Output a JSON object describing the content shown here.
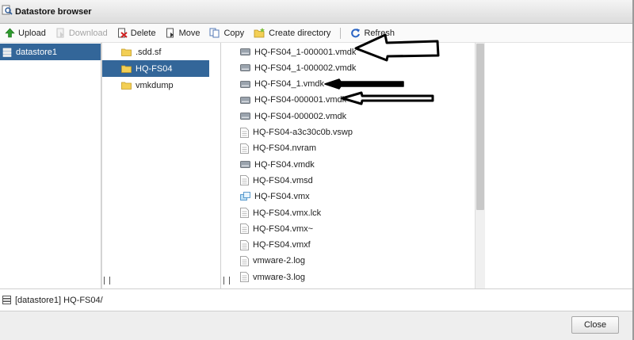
{
  "window": {
    "title": "Datastore browser"
  },
  "toolbar": {
    "upload": "Upload",
    "download": "Download",
    "delete": "Delete",
    "move": "Move",
    "copy": "Copy",
    "create_directory": "Create directory",
    "refresh": "Refresh"
  },
  "datastores": [
    {
      "label": "datastore1",
      "selected": true
    }
  ],
  "folders": [
    {
      "label": ".sdd.sf",
      "selected": false
    },
    {
      "label": "HQ-FS04",
      "selected": true
    },
    {
      "label": "vmkdump",
      "selected": false
    }
  ],
  "files": [
    {
      "label": "HQ-FS04_1-000001.vmdk",
      "icon": "disk-icon"
    },
    {
      "label": "HQ-FS04_1-000002.vmdk",
      "icon": "disk-icon"
    },
    {
      "label": "HQ-FS04_1.vmdk",
      "icon": "disk-icon"
    },
    {
      "label": "HQ-FS04-000001.vmdk",
      "icon": "disk-icon"
    },
    {
      "label": "HQ-FS04-000002.vmdk",
      "icon": "disk-icon"
    },
    {
      "label": "HQ-FS04-a3c30c0b.vswp",
      "icon": "file-icon"
    },
    {
      "label": "HQ-FS04.nvram",
      "icon": "file-icon"
    },
    {
      "label": "HQ-FS04.vmdk",
      "icon": "disk-icon"
    },
    {
      "label": "HQ-FS04.vmsd",
      "icon": "file-icon"
    },
    {
      "label": "HQ-FS04.vmx",
      "icon": "vm-icon"
    },
    {
      "label": "HQ-FS04.vmx.lck",
      "icon": "file-icon"
    },
    {
      "label": "HQ-FS04.vmx~",
      "icon": "file-icon"
    },
    {
      "label": "HQ-FS04.vmxf",
      "icon": "file-icon"
    },
    {
      "label": "vmware-2.log",
      "icon": "file-icon"
    },
    {
      "label": "vmware-3.log",
      "icon": "file-icon"
    }
  ],
  "path": "[datastore1] HQ-FS04/",
  "footer": {
    "close": "Close"
  },
  "colors": {
    "selection": "#336699",
    "titlebar": "#e4e4e4",
    "footer": "#eeeeee"
  }
}
